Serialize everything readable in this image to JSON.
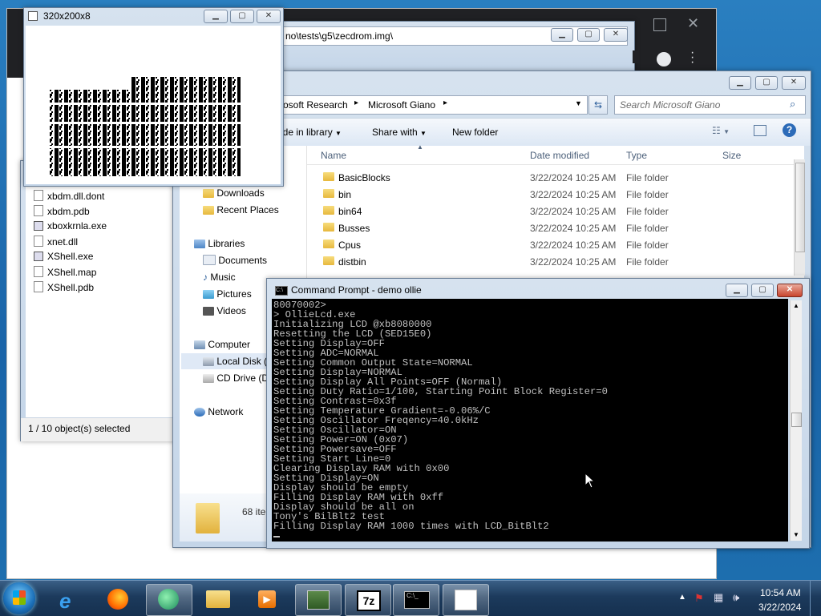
{
  "colors": {
    "desktop": "#1d6eae",
    "taskbar": "#1c3a5c",
    "console_bg": "#000000",
    "console_text": "#c0c0c0",
    "close_red": "#c9452e"
  },
  "lcd_window": {
    "title": "320x200x8"
  },
  "path_window": {
    "title": "no\\tests\\g5\\zecdrom.img\\"
  },
  "files_window": {
    "items": [
      "xbdm.dll.dont",
      "xbdm.pdb",
      "xboxkrnla.exe",
      "xnet.dll",
      "XShell.exe",
      "XShell.map",
      "XShell.pdb"
    ],
    "status": "1 / 10 object(s) selected"
  },
  "explorer": {
    "breadcrumb": [
      "rosoft Research",
      "Microsoft Giano"
    ],
    "search_placeholder": "Search Microsoft Giano",
    "toolbar": {
      "include": "ude in library",
      "share": "Share with",
      "new_folder": "New folder"
    },
    "columns": {
      "name": "Name",
      "date": "Date modified",
      "type": "Type",
      "size": "Size"
    },
    "nav": {
      "downloads": "Downloads",
      "recent": "Recent Places",
      "libraries": "Libraries",
      "documents": "Documents",
      "music": "Music",
      "pictures": "Pictures",
      "videos": "Videos",
      "computer": "Computer",
      "local_disk": "Local Disk (",
      "cd_drive": "CD Drive (D",
      "network": "Network"
    },
    "rows": [
      {
        "name": "BasicBlocks",
        "date": "3/22/2024 10:25 AM",
        "type": "File folder"
      },
      {
        "name": "bin",
        "date": "3/22/2024 10:25 AM",
        "type": "File folder"
      },
      {
        "name": "bin64",
        "date": "3/22/2024 10:25 AM",
        "type": "File folder"
      },
      {
        "name": "Busses",
        "date": "3/22/2024 10:25 AM",
        "type": "File folder"
      },
      {
        "name": "Cpus",
        "date": "3/22/2024 10:25 AM",
        "type": "File folder"
      },
      {
        "name": "distbin",
        "date": "3/22/2024 10:25 AM",
        "type": "File folder"
      }
    ],
    "details_count": "68 ite"
  },
  "console": {
    "title": "Command Prompt - demo  ollie",
    "lines": [
      "80070002>",
      "> OllieLcd.exe",
      "Initializing LCD @xb8080000",
      "Resetting the LCD (SED15E0)",
      "Setting Display=OFF",
      "Setting ADC=NORMAL",
      "Setting Common Output State=NORMAL",
      "Setting Display=NORMAL",
      "Setting Display All Points=OFF (Normal)",
      "Setting Duty Ratio=1/100, Starting Point Block Register=0",
      "Setting Contrast=0x3f",
      "Setting Temperature Gradient=-0.06%/C",
      "Setting Oscillator Freqency=40.0kHz",
      "Setting Oscillator=ON",
      "Setting Power=ON (0x07)",
      "Setting Powersave=OFF",
      "Setting Start Line=0",
      "Clearing Display RAM with 0x00",
      "Setting Display=ON",
      "Display should be empty",
      "Filling Display RAM with 0xff",
      "Display should be all on",
      "Tony's BilBlt2 test",
      "Filling Display RAM 1000 times with LCD_BitBlt2"
    ]
  },
  "taskbar": {
    "time": "10:54 AM",
    "date": "3/22/2024",
    "apps": [
      "start-orb",
      "internet-explorer",
      "firefox",
      "media-center",
      "file-explorer",
      "media-player",
      "system-monitor",
      "7-zip",
      "command-prompt",
      "document-viewer"
    ]
  }
}
